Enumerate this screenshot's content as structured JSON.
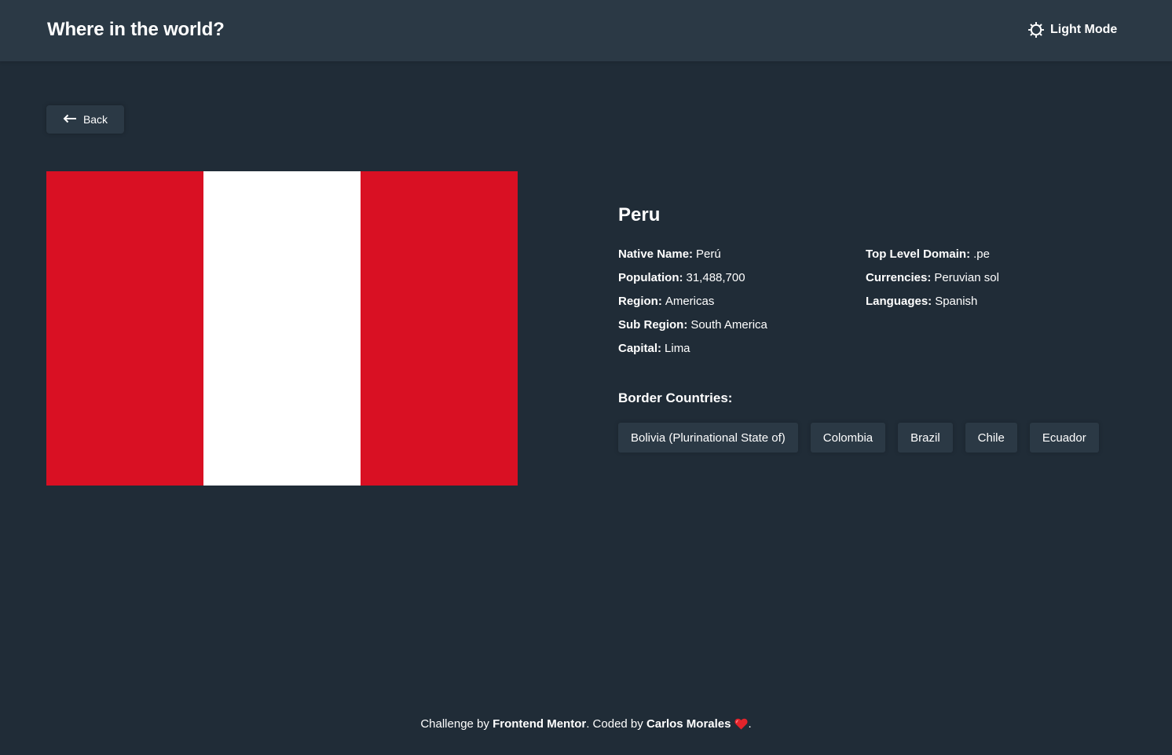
{
  "header": {
    "title": "Where in the world?",
    "theme_toggle_label": "Light Mode",
    "theme_icon": "sun-icon"
  },
  "back_button": {
    "label": "Back",
    "icon": "arrow-left-icon"
  },
  "flag": {
    "alt": "Flag of Peru",
    "stripes": [
      "#d91023",
      "#ffffff",
      "#d91023"
    ]
  },
  "country": {
    "name": "Peru",
    "details_left": [
      {
        "label": "Native Name:",
        "value": "Perú"
      },
      {
        "label": "Population:",
        "value": "31,488,700"
      },
      {
        "label": "Region:",
        "value": "Americas"
      },
      {
        "label": "Sub Region:",
        "value": "South America"
      },
      {
        "label": "Capital:",
        "value": "Lima"
      }
    ],
    "details_right": [
      {
        "label": "Top Level Domain:",
        "value": ".pe"
      },
      {
        "label": "Currencies:",
        "value": "Peruvian sol"
      },
      {
        "label": "Languages:",
        "value": "Spanish"
      }
    ],
    "border_title": "Border Countries:",
    "borders": [
      "Bolivia (Plurinational State of)",
      "Colombia",
      "Brazil",
      "Chile",
      "Ecuador"
    ]
  },
  "footer": {
    "prefix": "Challenge by ",
    "challenge_author": "Frontend Mentor",
    "middle": ". Coded by ",
    "coder": "Carlos Morales",
    "suffix": ".",
    "heart_icon": "heart-icon"
  },
  "colors": {
    "background": "#202c37",
    "elements": "#2b3945",
    "text": "#ffffff",
    "heart": "#e3242b"
  }
}
